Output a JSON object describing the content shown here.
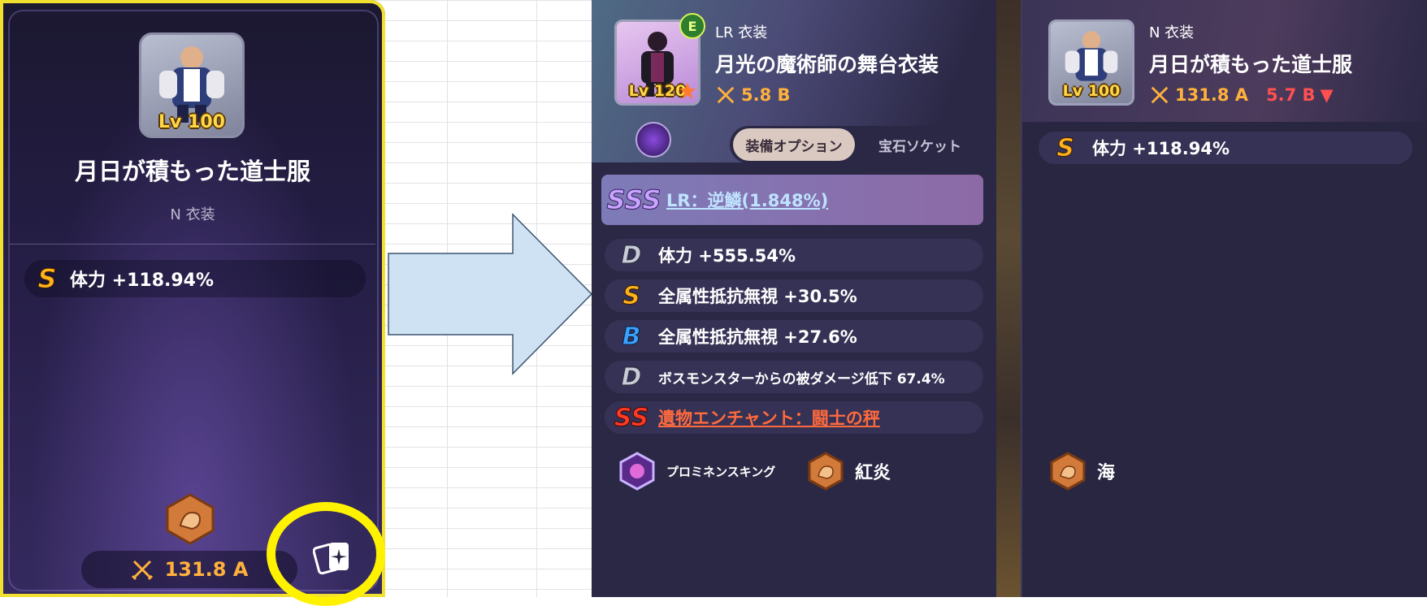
{
  "before_card": {
    "level": "Lv 100",
    "name": "月日が積もった道士服",
    "rarity_type": "N 衣装",
    "stat": {
      "grade": "S",
      "text": "体力 +118.94%"
    },
    "power": "131.8 A"
  },
  "after_panel": {
    "new_item": {
      "badge": "E",
      "level": "Lv 120",
      "rarity_type": "LR 衣装",
      "name": "月光の魔術師の舞台衣装",
      "power": "5.8 B",
      "tabs": [
        "装備オプション",
        "宝石ソケット"
      ],
      "special_option": {
        "grade": "SSS",
        "text": "LR：逆鱗(1.848%)"
      },
      "options": [
        {
          "grade": "D",
          "text": "体力 +555.54%"
        },
        {
          "grade": "S",
          "text": "全属性抵抗無視 +30.5%"
        },
        {
          "grade": "B",
          "text": "全属性抵抗無視 +27.6%"
        },
        {
          "grade": "D",
          "text": "ボスモンスターからの被ダメージ低下 67.4%"
        }
      ],
      "relic_enchant": {
        "grade": "SS",
        "text": "遺物エンチャント：闘士の秤"
      },
      "skills": [
        {
          "icon": "prominence-king-icon",
          "label": "プロミネンスキング"
        },
        {
          "icon": "fist-emblem-icon",
          "label": "紅炎"
        }
      ]
    },
    "equipped_item": {
      "level": "Lv 100",
      "rarity_type": "N 衣装",
      "name": "月日が積もった道士服",
      "power": "131.8 A",
      "power_diff": "5.7 B",
      "options": [
        {
          "grade": "S",
          "text": "体力 +118.94%"
        }
      ],
      "skills": [
        {
          "icon": "fist-emblem-icon",
          "label": "海"
        }
      ]
    }
  },
  "colors": {
    "highlight": "#fff200",
    "power": "#ffb13b",
    "arrow_fill": "#cfe2f3",
    "relic": "#ff6a3d"
  }
}
